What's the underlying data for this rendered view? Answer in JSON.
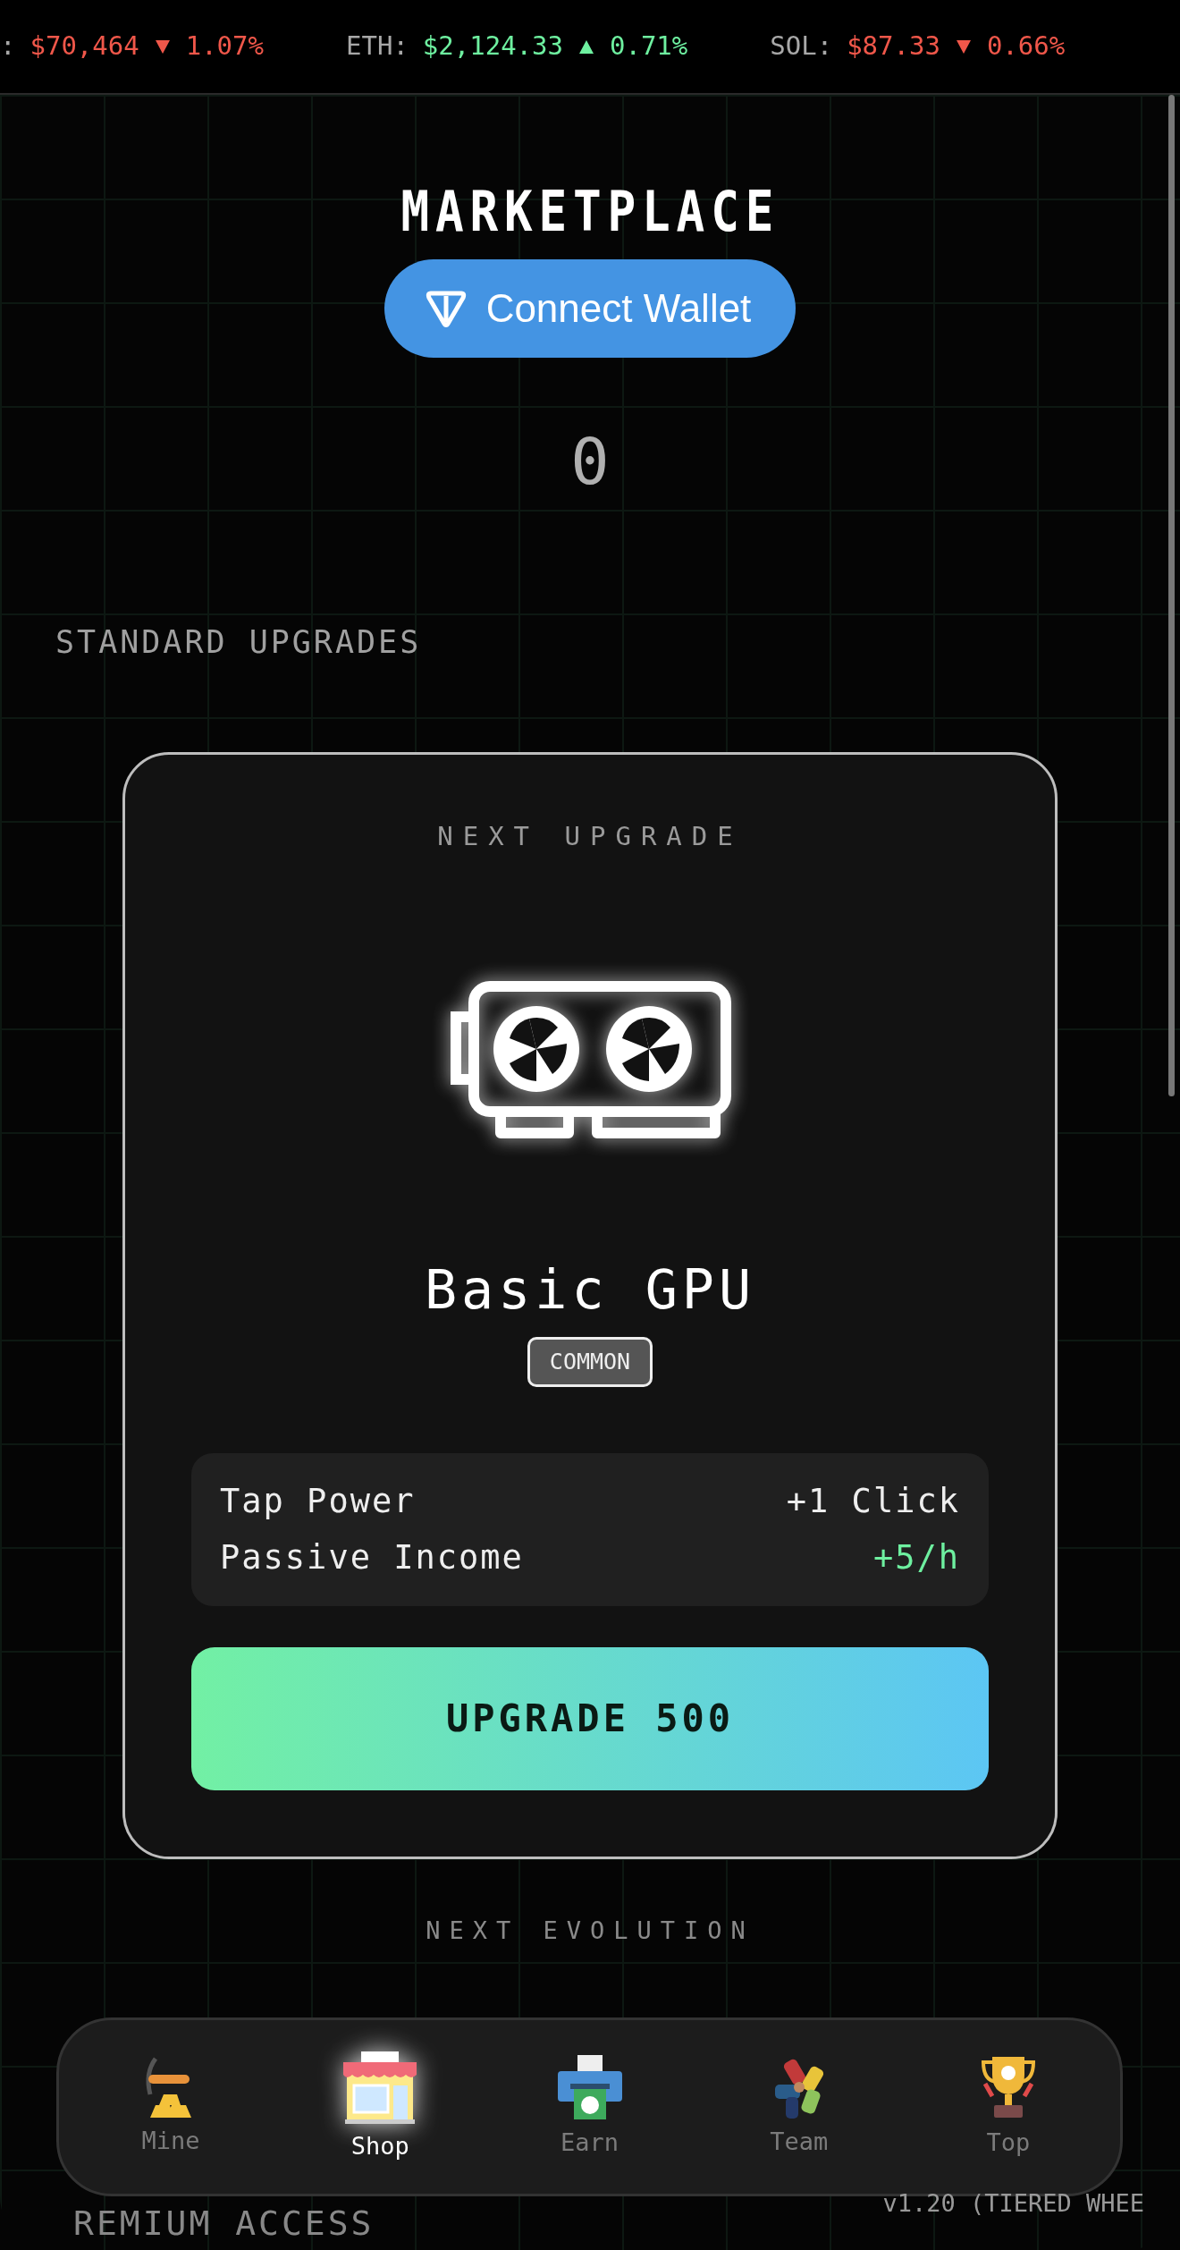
{
  "ticker": [
    {
      "label": ":",
      "price": "$70,464",
      "falling": true,
      "change": "1.07%"
    },
    {
      "label": "ETH:",
      "price": "$2,124.33",
      "falling": false,
      "change": "0.71%"
    },
    {
      "label": "SOL:",
      "price": "$87.33",
      "falling": true,
      "change": "0.66%"
    }
  ],
  "title": "MARKETPLACE",
  "wallet_button": "Connect Wallet",
  "balance": "0",
  "section_title": "STANDARD UPGRADES",
  "card": {
    "caption": "NEXT UPGRADE",
    "name": "Basic GPU",
    "rarity": "COMMON",
    "stats": [
      {
        "label": "Tap Power",
        "value": "+1 Click",
        "highlight": false
      },
      {
        "label": "Passive Income",
        "value": "+5/h",
        "highlight": true
      }
    ],
    "button": "UPGRADE 500"
  },
  "next_caption": "NEXT EVOLUTION",
  "nav": [
    {
      "label": "Mine",
      "selected": false
    },
    {
      "label": "Shop",
      "selected": true
    },
    {
      "label": "Earn",
      "selected": false
    },
    {
      "label": "Team",
      "selected": false
    },
    {
      "label": "Top",
      "selected": false
    }
  ],
  "version": "v1.20 (TIERED WHEE",
  "premium_title": "REMIUM ACCESS"
}
